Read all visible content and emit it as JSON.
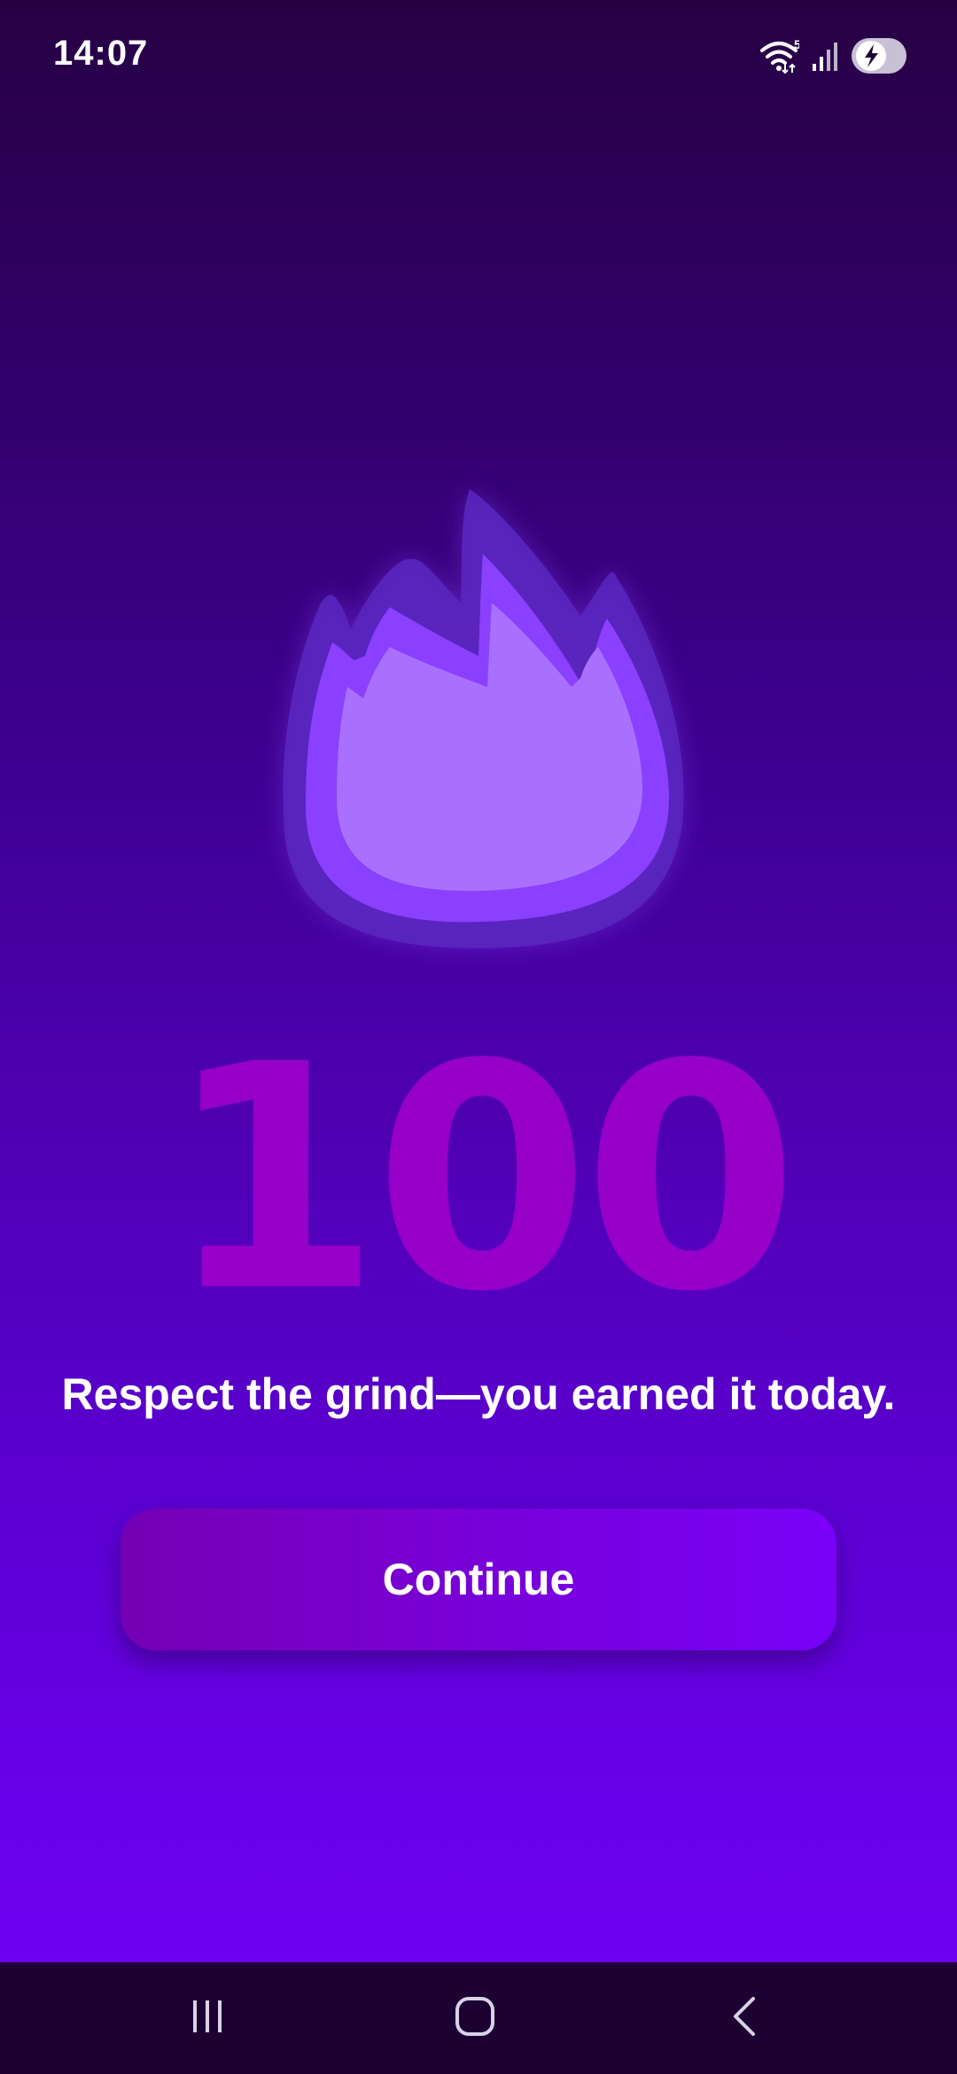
{
  "status_bar": {
    "time": "14:07",
    "icons": [
      "wifi-icon",
      "signal-icon",
      "battery-charging-icon"
    ],
    "wifi_badge": "5"
  },
  "streak": {
    "count": "100",
    "icon": "flame-icon"
  },
  "message": "Respect the grind—you earned it today.",
  "continue_button": {
    "label": "Continue"
  },
  "nav_bar": {
    "icons": [
      "recent-apps-icon",
      "home-icon",
      "back-icon"
    ]
  },
  "colors": {
    "background_top": "#270043",
    "background_bottom": "#7000f2",
    "number": "#9600c9",
    "button_start": "#7400b3",
    "button_end": "#7a00f8",
    "flame_outer": "#8a3cff",
    "flame_inner": "#a970ff",
    "nav_bar": "#1c0032"
  }
}
